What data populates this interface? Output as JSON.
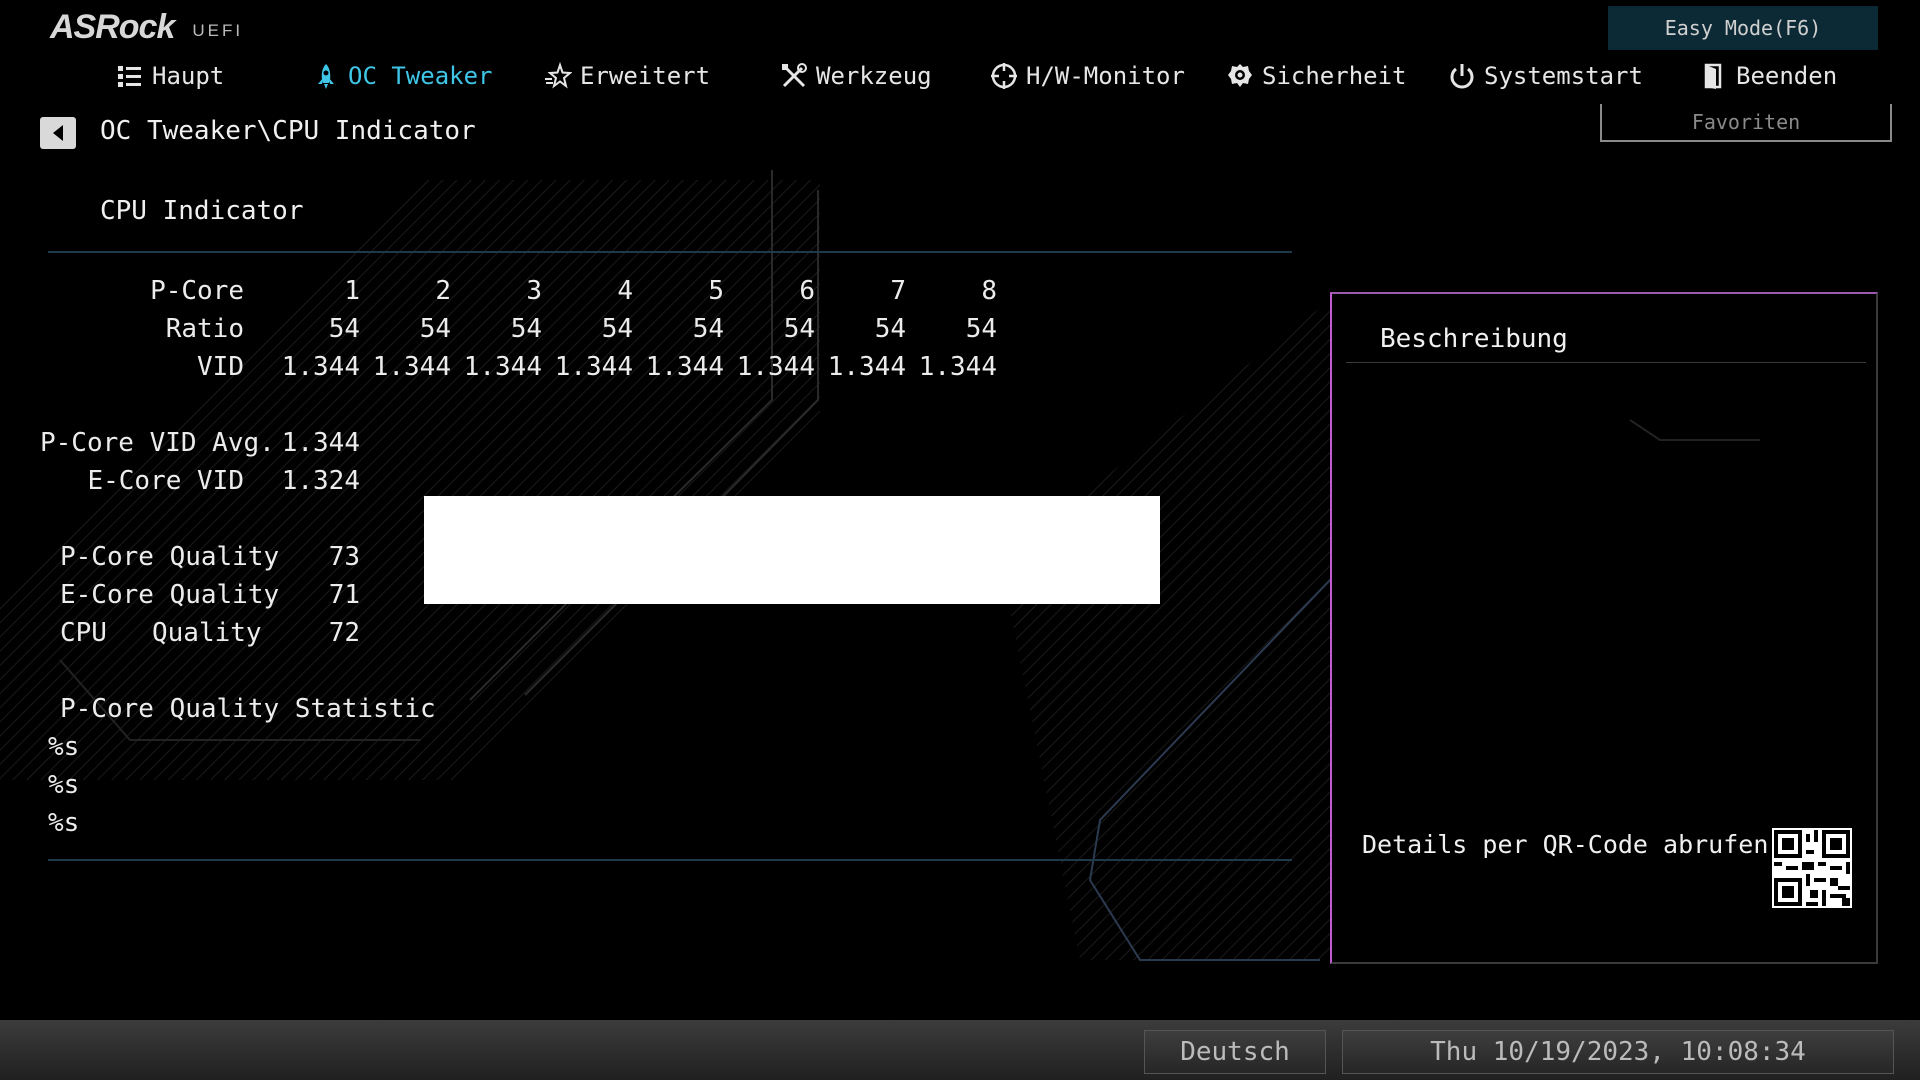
{
  "brand": {
    "logo": "ASRock",
    "sub": "UEFI"
  },
  "easy_mode": "Easy Mode(F6)",
  "nav": [
    {
      "label": "Haupt",
      "icon": "list-icon"
    },
    {
      "label": "OC Tweaker",
      "icon": "rocket-icon",
      "active": true
    },
    {
      "label": "Erweitert",
      "icon": "star-icon"
    },
    {
      "label": "Werkzeug",
      "icon": "tools-icon"
    },
    {
      "label": "H/W-Monitor",
      "icon": "crosshair-icon"
    },
    {
      "label": "Sicherheit",
      "icon": "shield-icon"
    },
    {
      "label": "Systemstart",
      "icon": "power-icon"
    },
    {
      "label": "Beenden",
      "icon": "exit-door-icon"
    }
  ],
  "favorites": "Favoriten",
  "breadcrumb": "OC Tweaker\\CPU Indicator",
  "section_title": "CPU Indicator",
  "table": {
    "header_label": "P-Core",
    "cores": [
      "1",
      "2",
      "3",
      "4",
      "5",
      "6",
      "7",
      "8"
    ],
    "ratio_label": "Ratio",
    "ratios": [
      "54",
      "54",
      "54",
      "54",
      "54",
      "54",
      "54",
      "54"
    ],
    "vid_label": "VID",
    "vids": [
      "1.344",
      "1.344",
      "1.344",
      "1.344",
      "1.344",
      "1.344",
      "1.344",
      "1.344"
    ]
  },
  "stats": {
    "pcore_vid_avg_label": "P-Core VID Avg.",
    "pcore_vid_avg": "1.344",
    "ecore_vid_label": "E-Core VID",
    "ecore_vid": "1.324",
    "pcore_quality_label": "P-Core Quality",
    "pcore_quality": "73",
    "ecore_quality_label": "E-Core Quality",
    "ecore_quality": "71",
    "cpu_quality_label_a": "CPU",
    "cpu_quality_label_b": "Quality",
    "cpu_quality": "72",
    "statistic_label": "P-Core Quality Statistic",
    "statistic_lines": [
      "%s",
      "%s",
      "%s"
    ]
  },
  "description": {
    "title": "Beschreibung",
    "qr_text": "Details per QR-Code abrufen"
  },
  "footer": {
    "language": "Deutsch",
    "datetime": "Thu 10/19/2023, 10:08:34"
  },
  "colors": {
    "accent": "#3fc6e6",
    "panel_border": "#c25ad4",
    "separator": "#1e3a4a"
  }
}
